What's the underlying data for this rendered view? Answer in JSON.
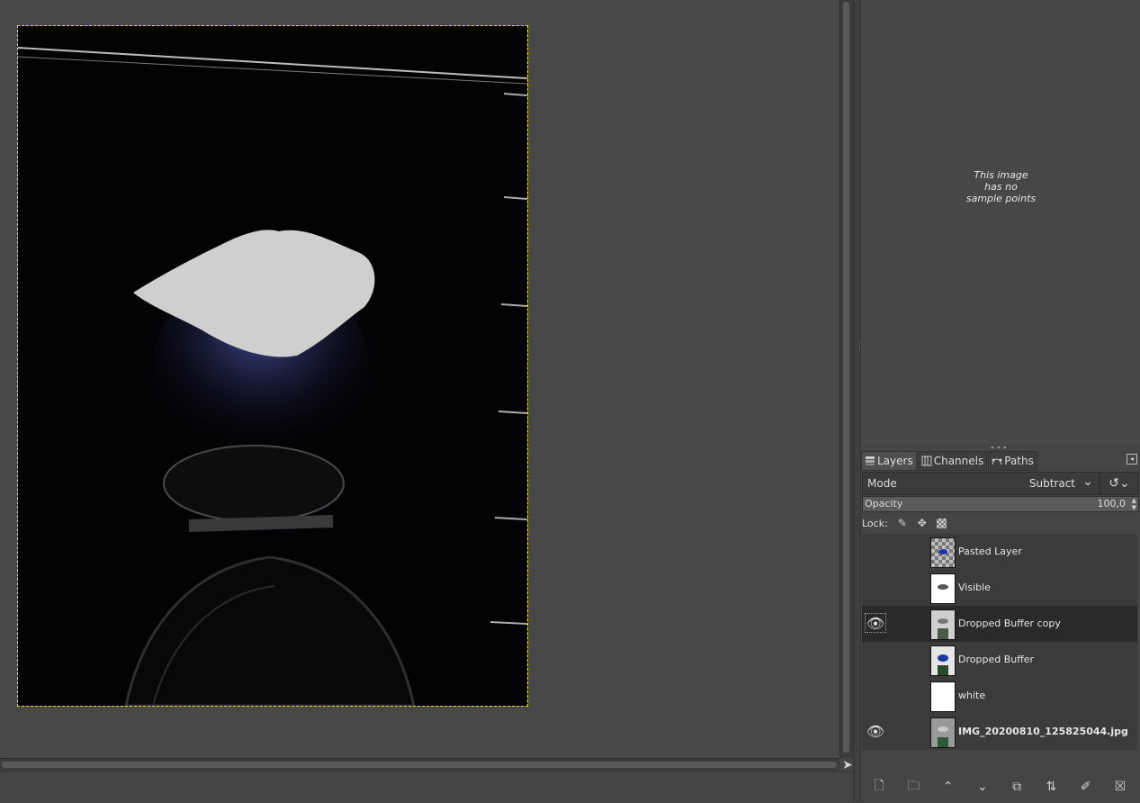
{
  "sample_points": {
    "message_lines": [
      "This image",
      "has no",
      "sample points"
    ]
  },
  "layers_panel": {
    "tabs": [
      {
        "label": "Layers",
        "icon": "layers-icon",
        "active": true
      },
      {
        "label": "Channels",
        "icon": "channels-icon",
        "active": false
      },
      {
        "label": "Paths",
        "icon": "paths-icon",
        "active": false
      }
    ],
    "mode_label": "Mode",
    "mode_value": "Subtract",
    "opacity_label": "Opacity",
    "opacity_value": "100,0",
    "lock_label": "Lock:",
    "layers": [
      {
        "name": "Pasted Layer",
        "visible": false,
        "selected": false,
        "bold": false,
        "thumb": "checker"
      },
      {
        "name": "Visible",
        "visible": false,
        "selected": false,
        "bold": false,
        "thumb": "white"
      },
      {
        "name": "Dropped Buffer copy",
        "visible": true,
        "selected": true,
        "bold": false,
        "thumb": "photo"
      },
      {
        "name": "Dropped Buffer",
        "visible": false,
        "selected": false,
        "bold": false,
        "thumb": "photo"
      },
      {
        "name": "white",
        "visible": false,
        "selected": false,
        "bold": false,
        "thumb": "white"
      },
      {
        "name": "IMG_20200810_125825044.jpg",
        "visible": true,
        "selected": false,
        "bold": true,
        "thumb": "photo"
      }
    ],
    "bottom_buttons": [
      "new-layer-icon",
      "new-layer-group-icon",
      "raise-layer-icon",
      "lower-layer-icon",
      "duplicate-layer-icon",
      "merge-layer-icon",
      "layer-mask-icon",
      "delete-layer-icon"
    ]
  },
  "colors": {
    "canvas_bg": "#484848",
    "image_bg": "#030305",
    "selection_border": "#e6e000",
    "selected_row": "#2a2a2a"
  }
}
